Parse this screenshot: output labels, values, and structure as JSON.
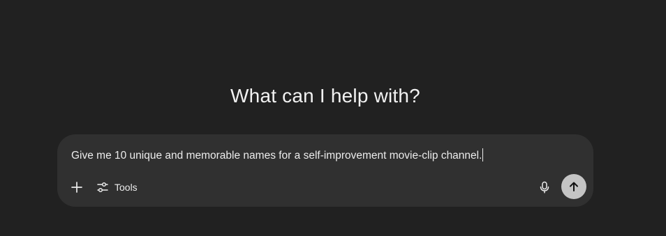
{
  "heading": "What can I help with?",
  "composer": {
    "input_value": "Give me 10 unique and memorable names for a self-improvement movie-clip channel."
  },
  "toolbar": {
    "add_icon": "plus-icon",
    "tools_icon": "sliders-icon",
    "tools_label": "Tools",
    "mic_icon": "microphone-icon",
    "send_icon": "arrow-up-icon"
  },
  "colors": {
    "background": "#212121",
    "composer": "#303030",
    "send_button": "#c4c4c4",
    "text": "#ececec"
  }
}
